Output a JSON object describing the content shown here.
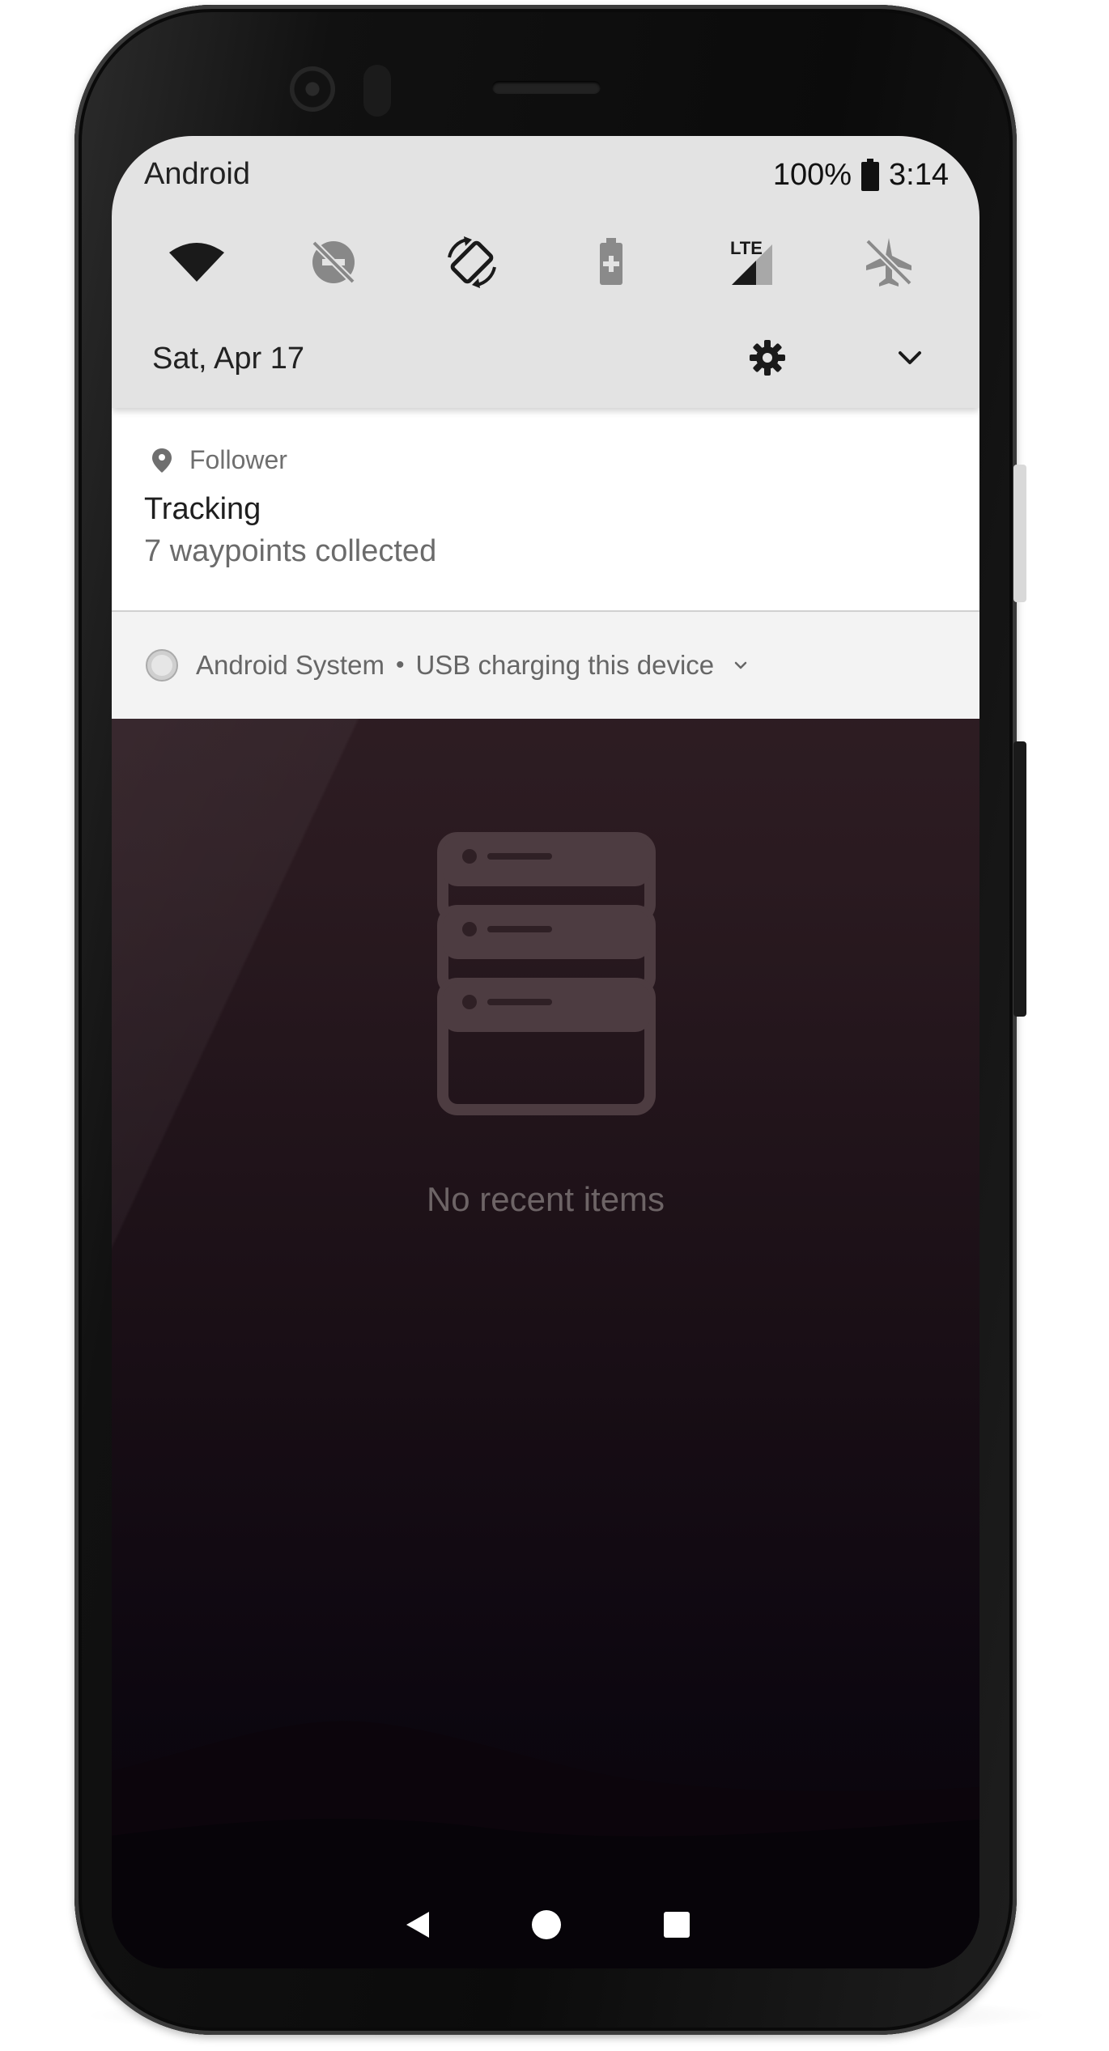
{
  "status_bar": {
    "carrier": "Android",
    "battery_percent": "100%",
    "time": "3:14"
  },
  "quick_settings": {
    "tiles": [
      {
        "icon": "wifi-icon",
        "state": "on"
      },
      {
        "icon": "do-not-disturb-off-icon",
        "state": "off"
      },
      {
        "icon": "auto-rotate-icon",
        "state": "on"
      },
      {
        "icon": "battery-saver-icon",
        "state": "off"
      },
      {
        "icon": "mobile-data-lte-icon",
        "label": "LTE",
        "state": "on"
      },
      {
        "icon": "airplane-mode-off-icon",
        "state": "off"
      }
    ],
    "date": "Sat, Apr 17"
  },
  "notifications": {
    "follower": {
      "app_name": "Follower",
      "title": "Tracking",
      "text": "7 waypoints collected"
    },
    "system": {
      "app_name": "Android System",
      "separator": "•",
      "text": "USB charging this device"
    }
  },
  "recents": {
    "empty_message": "No recent items"
  },
  "colors": {
    "shade_background": "#e3e3e3",
    "notification_background": "#ffffff",
    "system_notification_background": "#f3f3f3",
    "wallpaper_top": "#3a262d",
    "wallpaper_bottom": "#08050a"
  }
}
